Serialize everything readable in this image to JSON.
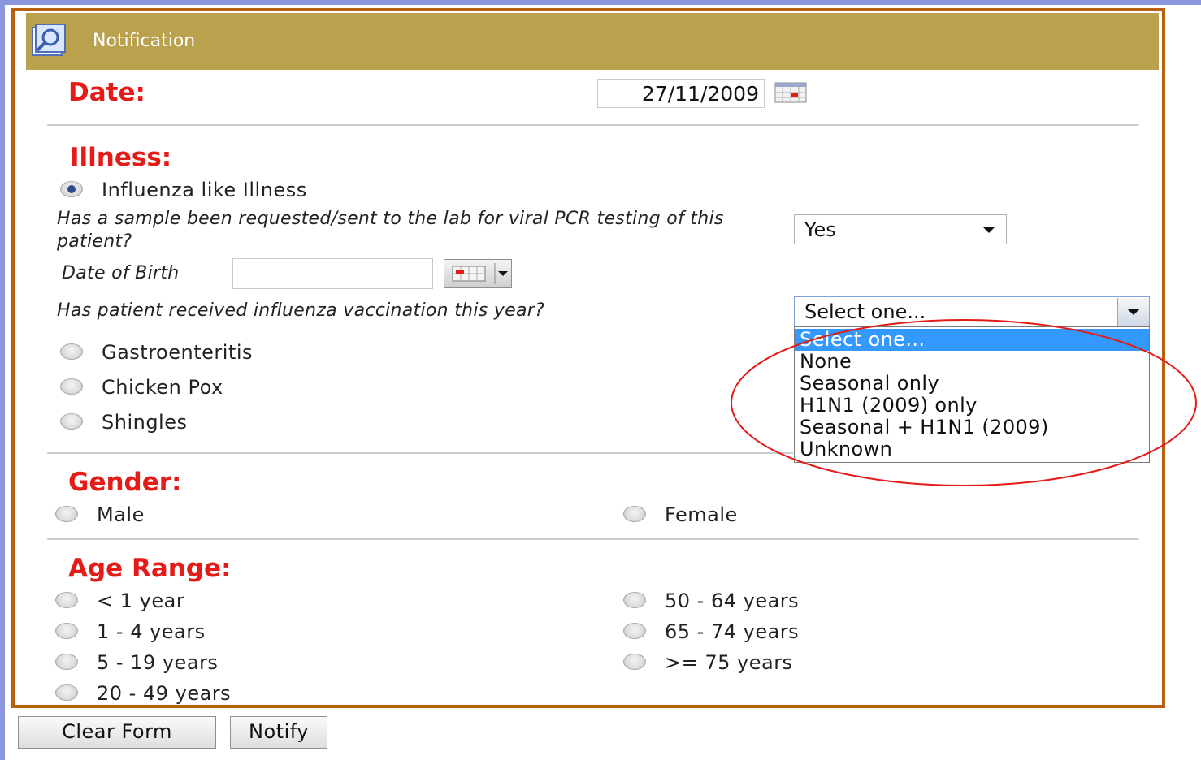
{
  "panel": {
    "title": "Notification"
  },
  "date": {
    "label": "Date:",
    "value": "27/11/2009"
  },
  "illness": {
    "label": "Illness:",
    "influenza_label": "Influenza like Illness",
    "pcr_question": "Has a sample been requested/sent to the lab for viral PCR testing of this patient?",
    "pcr_answer": "Yes",
    "dob_label": "Date of Birth",
    "dob_value": "",
    "vaccination_question": "Has patient received influenza vaccination this year?",
    "vaccination_selected": "Select one...",
    "vaccination_options": [
      "Select one...",
      "None",
      "Seasonal only",
      "H1N1 (2009) only",
      "Seasonal + H1N1 (2009)",
      "Unknown"
    ],
    "other_options": [
      "Gastroenteritis",
      "Chicken Pox",
      "Shingles"
    ]
  },
  "gender": {
    "label": "Gender:",
    "male": "Male",
    "female": "Female"
  },
  "age": {
    "label": "Age Range:",
    "left": [
      "< 1 year",
      "1 - 4 years",
      "5 - 19 years",
      "20 - 49 years"
    ],
    "right": [
      "50 - 64 years",
      "65 - 74 years",
      ">= 75 years"
    ]
  },
  "buttons": {
    "clear": "Clear Form",
    "notify": "Notify"
  },
  "annotation_color": "#e41b17"
}
